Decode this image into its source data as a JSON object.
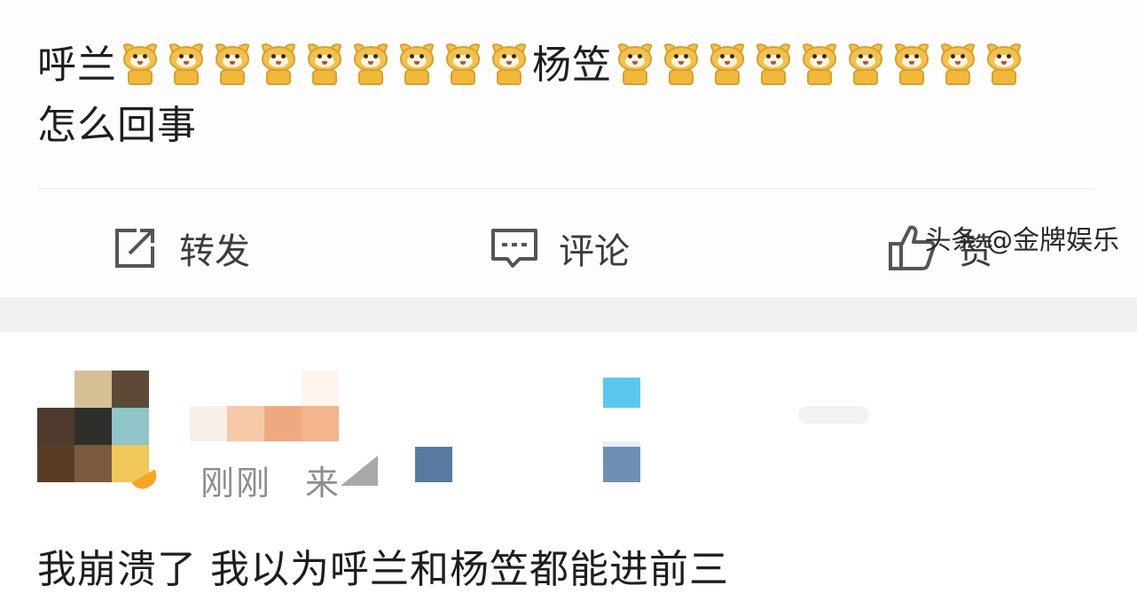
{
  "post": {
    "text_prefix": "呼兰",
    "text_middle": "杨笠",
    "text_suffix": "怎么回事",
    "emoji_name": "doge-crying-icon",
    "emoji_count_first": 9,
    "emoji_count_second": 9
  },
  "actions": {
    "repost_label": "转发",
    "comment_label": "评论",
    "like_label": "赞"
  },
  "comment": {
    "time": "刚刚",
    "source_prefix": "来",
    "text": "我崩溃了 我以为呼兰和杨笠都能进前三"
  },
  "watermark": "头条 @金牌娱乐",
  "colors": {
    "background": "#ffffff",
    "band": "#f0f0f0",
    "emoji": "#f2c14e",
    "meta_text": "#8e8e8e"
  }
}
